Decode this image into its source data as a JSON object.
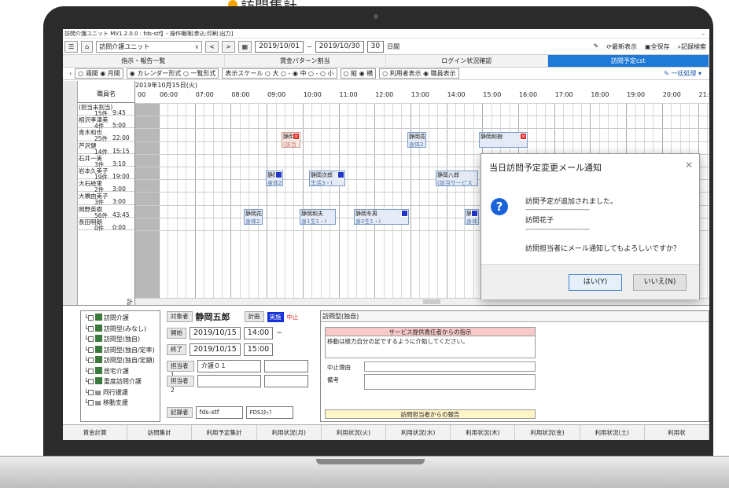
{
  "caption": "訪問集計",
  "window": {
    "title": "訪問介護ユニット MV1.2.0.0 : fds-stf】- 操作権限[参込:印刷:出力]",
    "minimize": "–"
  },
  "toolbar": {
    "unit_select": "訪問介護ユニット",
    "prev": "<",
    "next": ">",
    "date_from": "2019/10/01",
    "tilde": "~",
    "date_to": "2019/10/30",
    "days": "30",
    "days_unit": "日間",
    "refresh": "最新表示",
    "save_all": "全保存",
    "record_search": "記録検索"
  },
  "nav_tabs": [
    "指示・報告一覧",
    "賃金パターン割当",
    "ログイン状況確認",
    "訪問予定cst"
  ],
  "options": {
    "period": "○ 週間 ◉ 月間",
    "form": "◉ カレンダー形式 ○ 一覧形式",
    "scale": "表示スケール ○ 大 ○ - ◉ 中 ○ - ○ 小",
    "orient": "○ 縦 ◉ 横",
    "display": "○ 利用者表示 ◉ 職員表示",
    "bulk": "一括処理 ▾"
  },
  "schedule": {
    "date_label": "2019年10月15日(火)",
    "name_header": "職員名",
    "hours": [
      "00",
      "06:00",
      "07:00",
      "08:00",
      "09:00",
      "10:00",
      "11:00",
      "12:00",
      "13:00",
      "14:00",
      "15:00",
      "16:00",
      "17:00",
      "18:00",
      "19:00",
      "20:00",
      "21:"
    ],
    "staff": [
      {
        "name": "(担当未割当)",
        "count": "15件",
        "hours": "9:45"
      },
      {
        "name": "相沢孝津美",
        "count": "4件",
        "hours": "5:00"
      },
      {
        "name": "青木和也",
        "count": "25件",
        "hours": "22:00"
      },
      {
        "name": "芦沢健",
        "count": "14件",
        "hours": "15:15"
      },
      {
        "name": "石井一美",
        "count": "3件",
        "hours": "3:10"
      },
      {
        "name": "岩本久美子",
        "count": "19件",
        "hours": "19:00"
      },
      {
        "name": "大石絵里",
        "count": "2件",
        "hours": "3:00"
      },
      {
        "name": "大橋由美子",
        "count": "3件",
        "hours": "3:00"
      },
      {
        "name": "岡野英樹",
        "count": "56件",
        "hours": "43:45"
      },
      {
        "name": "長田明朗",
        "count": "0件",
        "hours": "0:00"
      }
    ],
    "total_label": "計",
    "visits": [
      {
        "name": "静岡次",
        "sub": "(該当サ",
        "cancel": true,
        "row": 2,
        "badge": "x"
      },
      {
        "name": "静岡花",
        "sub": "身体2",
        "cancel": false,
        "row": 2,
        "badge": ""
      },
      {
        "name": "静岡和樹",
        "sub": "",
        "cancel": false,
        "row": 2,
        "badge": "x"
      },
      {
        "name": "静岡",
        "sub": "身体2",
        "cancel": false,
        "row": 5,
        "badge": "o"
      },
      {
        "name": "静岡次郎",
        "sub": "生活3・I",
        "cancel": false,
        "row": 5,
        "badge": "o"
      },
      {
        "name": "静岡八郎",
        "sub": "(該当サービスなし)",
        "cancel": false,
        "row": 5,
        "badge": ""
      },
      {
        "name": "静岡花",
        "sub": "身体2",
        "cancel": false,
        "row": 8,
        "badge": ""
      },
      {
        "name": "静岡和夫",
        "sub": "身1生1・I",
        "cancel": false,
        "row": 8,
        "badge": ""
      },
      {
        "name": "静岡冬男",
        "sub": "身2生1・I",
        "cancel": false,
        "row": 8,
        "badge": "o"
      },
      {
        "name": "静岡",
        "sub": "身体2",
        "cancel": false,
        "row": 8,
        "badge": "o"
      }
    ]
  },
  "tree": [
    {
      "label": "訪問介護",
      "tag": true
    },
    {
      "label": "訪問型(みなし)",
      "tag": true
    },
    {
      "label": "訪問型(独自)",
      "tag": true
    },
    {
      "label": "訪問型(独自/定率)",
      "tag": true
    },
    {
      "label": "訪問型(独自/定額)",
      "tag": true
    },
    {
      "label": "居宅介護",
      "tag": true
    },
    {
      "label": "重度訪問介護",
      "tag": true
    },
    {
      "label": "同行援護",
      "tag": false
    },
    {
      "label": "移動支援",
      "tag": false
    }
  ],
  "form": {
    "subject_label": "対象者",
    "subject": "静岡五郎",
    "plan": "計画",
    "actual": "実施",
    "stop": "中止",
    "start_label": "開始",
    "start_date": "2019/10/15",
    "start_time": "14:00",
    "tilde": "~",
    "end_label": "終了",
    "end_date": "2019/10/15",
    "end_time": "15:00",
    "staff1_label": "担当者1",
    "staff1": "介護０１",
    "staff2_label": "担当者2",
    "recorder_label": "記録者",
    "recorder": "fds-stf",
    "recorder_name": "FDSｽﾀｯﾌ"
  },
  "detail": {
    "title": "訪問型(独自)",
    "instruction_header": "サービス提供責任者からの指示",
    "instruction_text": "移動は極力自分の足でするように介助してください。",
    "stop_reason_label": "中止理由",
    "note_label": "備考",
    "report_header": "訪問担当者からの報告"
  },
  "footer_tabs": [
    "賃金計算",
    "訪問集計",
    "利用予定集計",
    "利用状況(月)",
    "利用状況(火)",
    "利用状況(水)",
    "利用状況(木)",
    "利用状況(金)",
    "利用状況(土)",
    "利用状"
  ],
  "dialog": {
    "title": "当日訪問予定変更メール通知",
    "close": "✕",
    "line1": "訪問予定が追加されました。",
    "separator": "-------------------------------------------",
    "line2": "訪問花子",
    "question": "訪問担当者にメール通知してもよろしいですか？",
    "yes": "はい(Y)",
    "no": "いいえ(N)"
  }
}
